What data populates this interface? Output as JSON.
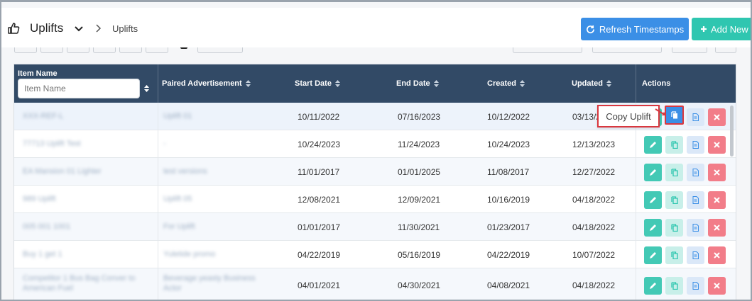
{
  "header": {
    "title": "Uplifts",
    "breadcrumb": "Uplifts",
    "refresh_label": "Refresh Timestamps",
    "add_label": "Add New"
  },
  "table": {
    "columns": {
      "item_name": "Item Name",
      "paired": "Paired Advertisement",
      "start": "Start Date",
      "end": "End Date",
      "created": "Created",
      "updated": "Updated",
      "actions": "Actions"
    },
    "item_name_placeholder": "Item Name",
    "rows": [
      {
        "item": "XXX-REF-L",
        "paired": "Uplift 01",
        "start": "10/11/2022",
        "end": "07/16/2023",
        "created": "10/12/2022",
        "updated": "03/13/2023"
      },
      {
        "item": "77713 Uplift Test",
        "paired": "-",
        "start": "10/24/2023",
        "end": "11/24/2023",
        "created": "10/24/2023",
        "updated": "12/13/2023"
      },
      {
        "item": "EA Mansion 01 Lighter",
        "paired": "test versions",
        "start": "11/01/2017",
        "end": "01/01/2025",
        "created": "11/08/2017",
        "updated": "12/27/2022"
      },
      {
        "item": "989 Uplift",
        "paired": "Uplift 05",
        "start": "12/08/2021",
        "end": "12/09/2021",
        "created": "10/16/2019",
        "updated": "04/18/2022"
      },
      {
        "item": "005 001 1001",
        "paired": "For Uplift",
        "start": "01/01/2017",
        "end": "11/30/2021",
        "created": "01/23/2017",
        "updated": "04/18/2022"
      },
      {
        "item": "Buy 1 get 1",
        "paired": "Yuletide promo",
        "start": "04/22/2019",
        "end": "05/16/2019",
        "created": "04/22/2019",
        "updated": "10/07/2022"
      },
      {
        "item": "Competitor 1 Bus Bag Conver to American Fuel",
        "paired": "Beverage yeasty Business Actor",
        "start": "04/01/2021",
        "end": "04/30/2021",
        "created": "04/08/2021",
        "updated": "04/18/2022"
      }
    ]
  },
  "tooltip": {
    "text": "Copy Uplift"
  },
  "colors": {
    "header_bg": "#324a66",
    "refresh_btn": "#3b8fe6",
    "add_btn": "#2fc6b0",
    "edit_btn": "#43c9b5",
    "delete_btn": "#f27d89",
    "highlight": "#d9373f"
  },
  "icons": [
    "thumbs-up-icon",
    "chevron-down-icon",
    "chevron-right-icon",
    "refresh-icon",
    "plus-icon",
    "sort-icon",
    "edit-icon",
    "copy-icon",
    "document-icon",
    "delete-icon"
  ]
}
